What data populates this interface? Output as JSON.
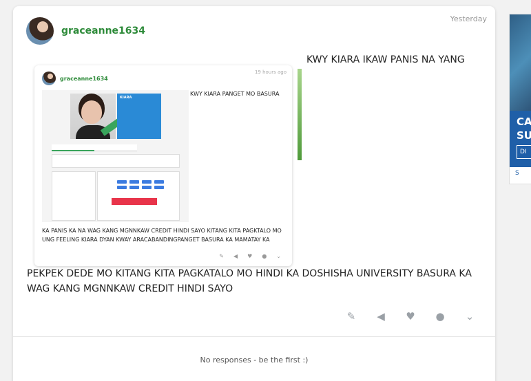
{
  "post": {
    "username": "graceanne1634",
    "timestamp": "Yesterday",
    "title_text": "KWY KIARA IKAW PANIS NA YANG",
    "body": "PEKPEK DEDE MO KITANG KITA PAGKATALO MO HINDI KA DOSHISHA UNIVERSITY BASURA KA WAG KANG MGNNKAW CREDIT HINDI SAYO"
  },
  "embedded": {
    "username": "graceanne1634",
    "timestamp": "19 hours ago",
    "post_text": "KWY KIARA PANGET MO BASURA",
    "profile_name": "KIARA",
    "comment": "KA PANIS KA NA WAG KANG MGNNKAW CREDIT HINDI SAYO KITANG KITA PAGKTALO MO UNG FEELING KIARA DYAN KWAY ARACABANDINGPANGET BASURA KA MAMATAY KA"
  },
  "responses": {
    "empty_text": "No responses - be the first :)"
  },
  "ad": {
    "headline": "CA SU",
    "button": "DI",
    "logo": "S"
  },
  "colors": {
    "username": "#2e8b3a",
    "icon_gray": "#9aa0a6"
  }
}
